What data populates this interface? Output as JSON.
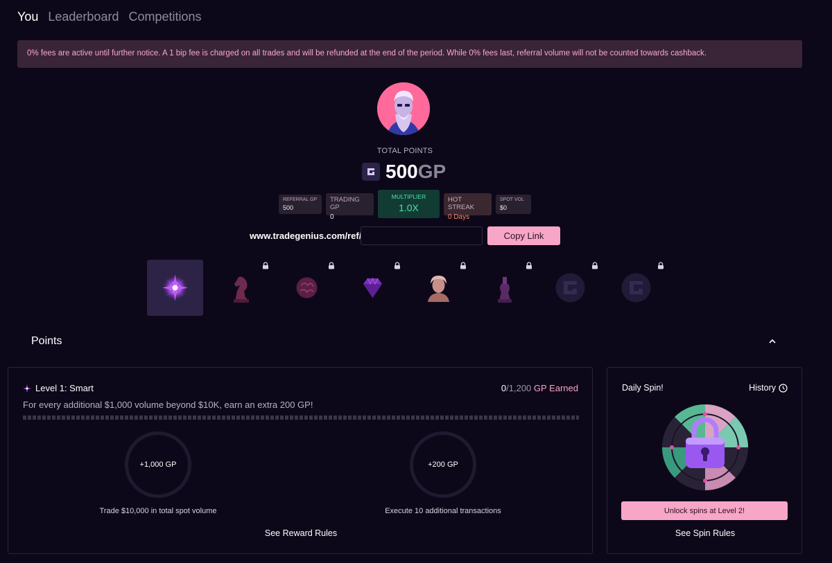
{
  "tabs": [
    {
      "label": "You",
      "active": true
    },
    {
      "label": "Leaderboard",
      "active": false
    },
    {
      "label": "Competitions",
      "active": false
    }
  ],
  "notice": "0% fees are active until further notice. A 1 bip fee is charged on all trades and will be refunded at the end of the period. While 0% fees last, referral volume will not be counted towards cashback.",
  "profile": {
    "total_label": "TOTAL POINTS",
    "total_value": "500",
    "total_unit": "GP"
  },
  "stats": {
    "referral": {
      "label": "REFERRAL GP",
      "value": "500"
    },
    "trading": {
      "label": "TRADING GP",
      "value": "0"
    },
    "multiplier": {
      "label": "MULTIPLIER",
      "value": "1.0X"
    },
    "hot_streak": {
      "label": "HOT STREAK",
      "value": "0 Days"
    },
    "spot_vol": {
      "label": "SPOT VOL",
      "value": "$0"
    }
  },
  "referral_link": {
    "prefix": "www.tradegenius.com/ref/",
    "value": "",
    "copy_label": "Copy Link"
  },
  "badges": [
    {
      "name": "spark",
      "locked": false,
      "selected": true
    },
    {
      "name": "chess-knight",
      "locked": true
    },
    {
      "name": "brain",
      "locked": true
    },
    {
      "name": "gem",
      "locked": true
    },
    {
      "name": "bust",
      "locked": true
    },
    {
      "name": "chess-king",
      "locked": true
    },
    {
      "name": "genius-coin",
      "locked": true
    },
    {
      "name": "genius-coin",
      "locked": true
    }
  ],
  "points": {
    "title": "Points",
    "level": {
      "title": "Level 1: Smart",
      "earned_current": "0",
      "earned_total": "/1,200",
      "earned_unit": " GP Earned",
      "description": "For every additional $1,000 volume beyond $10K, earn an extra 200 GP!",
      "progress": 0
    },
    "tasks": [
      {
        "reward": "+1,000 GP",
        "label": "Trade $10,000 in total spot volume"
      },
      {
        "reward": "+200 GP",
        "label": "Execute 10 additional transactions"
      }
    ],
    "rules_link": "See Reward Rules"
  },
  "spin": {
    "title": "Daily Spin!",
    "history_label": "History",
    "unlock_label": "Unlock spins at Level 2!",
    "rules_link": "See Spin Rules"
  },
  "colors": {
    "background": "#0d0819",
    "accent_pink": "#f7a6c8",
    "multiplier_green": "#4ee2a8",
    "streak_orange": "#ff8a70"
  }
}
